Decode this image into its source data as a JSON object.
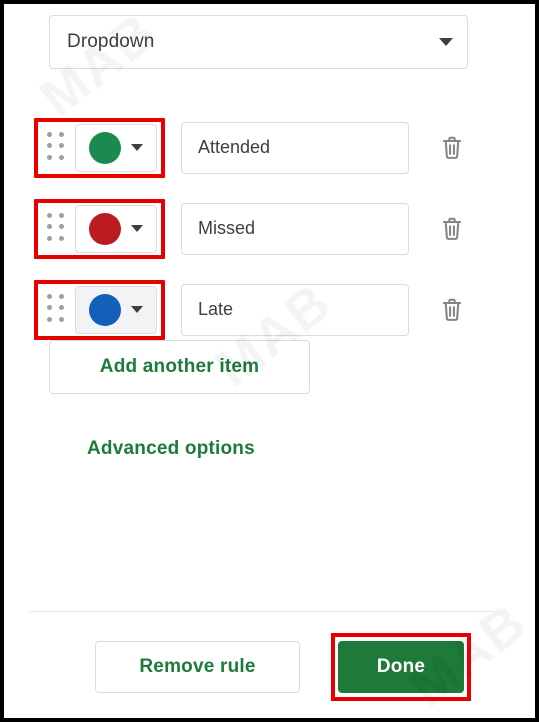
{
  "panel": {
    "type_selector": {
      "value": "Dropdown",
      "caret_icon": "chevron-down-icon"
    },
    "items": [
      {
        "color": "#1b8a50",
        "color_name": "green",
        "value": "Attended",
        "placeholder": "Value",
        "chip_state": "default",
        "handle_icon": "drag-handle-icon",
        "delete_icon": "trash-icon",
        "caret_icon": "chevron-down-icon",
        "annotated": true
      },
      {
        "color": "#bc1c21",
        "color_name": "red",
        "value": "Missed",
        "placeholder": "Value",
        "chip_state": "default",
        "handle_icon": "drag-handle-icon",
        "delete_icon": "trash-icon",
        "caret_icon": "chevron-down-icon",
        "annotated": true
      },
      {
        "color": "#1360b9",
        "color_name": "blue",
        "value": "Late",
        "placeholder": "Value",
        "chip_state": "hovered",
        "handle_icon": "drag-handle-icon",
        "delete_icon": "trash-icon",
        "caret_icon": "chevron-down-icon",
        "annotated": true
      }
    ],
    "add_item_label": "Add another item",
    "advanced_options_label": "Advanced options",
    "footer": {
      "remove_rule_label": "Remove rule",
      "done_label": "Done",
      "done_annotated": true
    }
  },
  "colors": {
    "accent_green": "#1e7b3c",
    "done_green": "#1d7a38",
    "annotation_red": "#e60000",
    "border_grey": "#dadce0",
    "text_grey": "#3c4043",
    "icon_grey": "#9aa0a6"
  },
  "watermark": {
    "text": "MAB"
  }
}
